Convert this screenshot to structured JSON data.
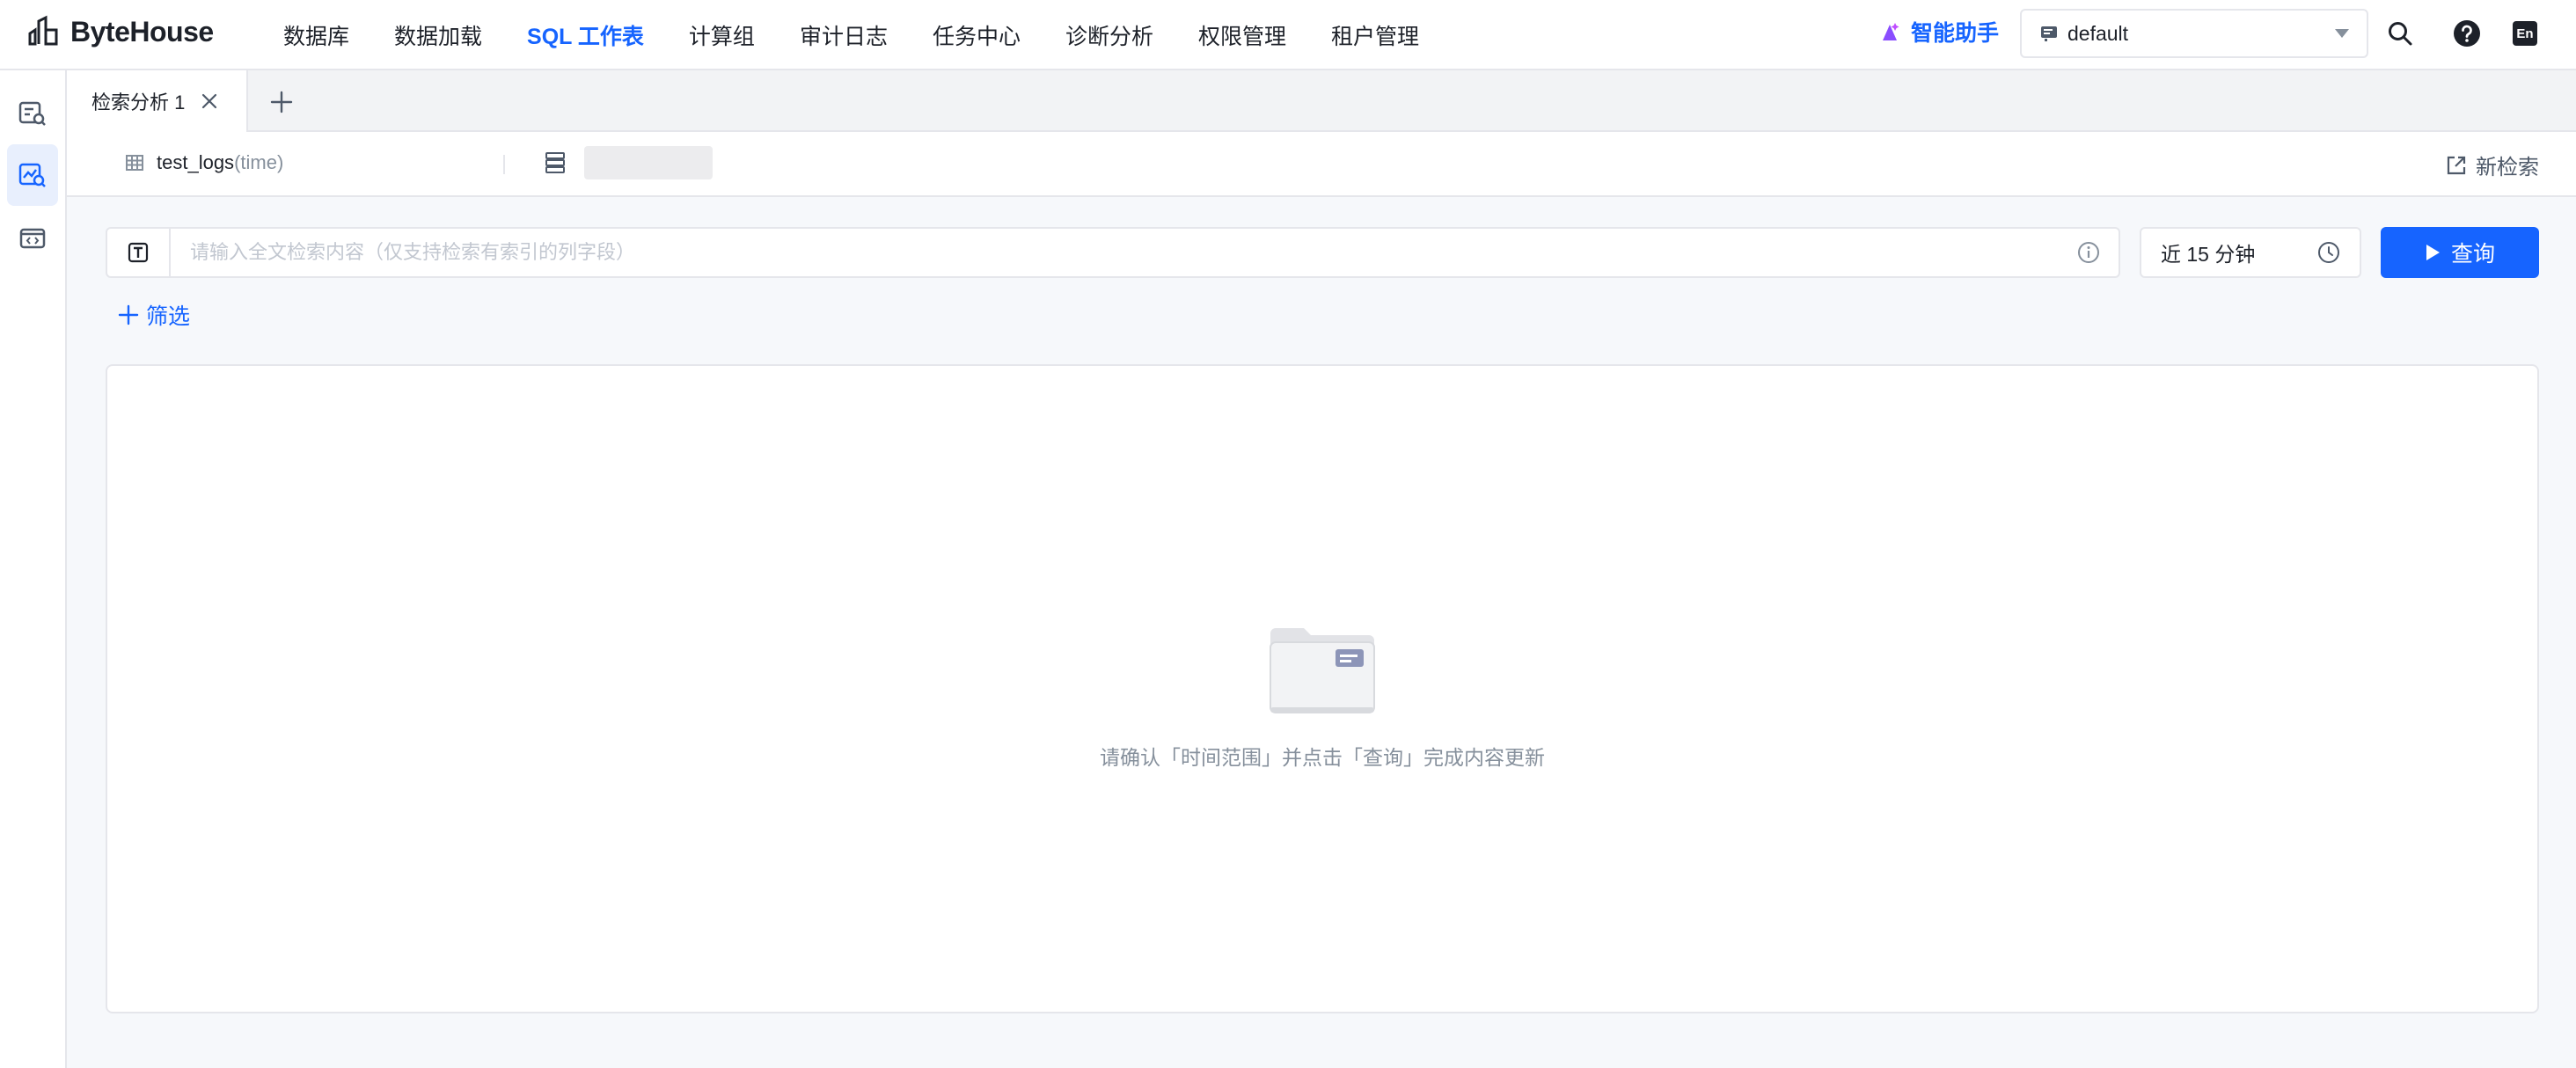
{
  "brand": {
    "name": "ByteHouse"
  },
  "nav": {
    "items": [
      {
        "label": "数据库",
        "active": false
      },
      {
        "label": "数据加载",
        "active": false
      },
      {
        "label": "SQL 工作表",
        "active": true
      },
      {
        "label": "计算组",
        "active": false
      },
      {
        "label": "审计日志",
        "active": false
      },
      {
        "label": "任务中心",
        "active": false
      },
      {
        "label": "诊断分析",
        "active": false
      },
      {
        "label": "权限管理",
        "active": false
      },
      {
        "label": "租户管理",
        "active": false
      }
    ],
    "assistant_label": "智能助手",
    "workspace_value": "default",
    "lang_label": "En"
  },
  "tabs": [
    {
      "label": "检索分析 1"
    }
  ],
  "source": {
    "table": "test_logs",
    "table_suffix": "(time)",
    "new_search_label": "新检索"
  },
  "search": {
    "placeholder": "请输入全文检索内容（仅支持检索有索引的列字段）",
    "type_icon_label": "T",
    "time_range": "近 15 分钟",
    "query_label": "查询",
    "filter_label": "筛选"
  },
  "result": {
    "empty_text": "请确认「时间范围」并点击「查询」完成内容更新"
  },
  "colors": {
    "accent": "#1664ff",
    "border": "#e5e6eb",
    "muted_text": "#86909c",
    "assistant_icon": "#8a4dff"
  }
}
